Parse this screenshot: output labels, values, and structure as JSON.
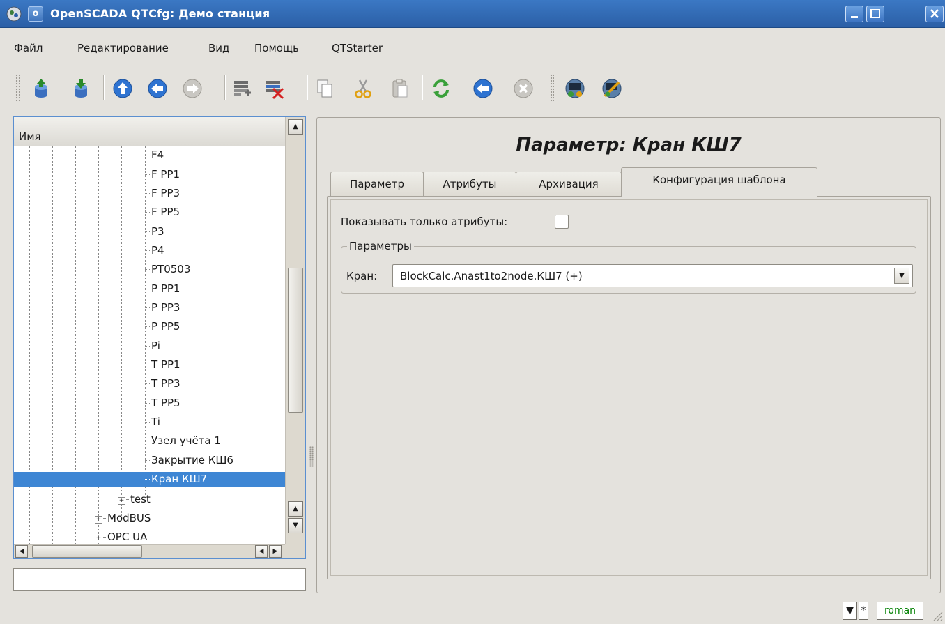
{
  "window": {
    "title": "OpenSCADA QTCfg: Демо станция",
    "menu_button": "o"
  },
  "menubar": {
    "items": [
      "Файл",
      "Редактирование",
      "Вид",
      "Помощь",
      "QTStarter"
    ]
  },
  "toolbar": {
    "icons": [
      "db-load-icon",
      "db-save-icon",
      "up-icon",
      "back-icon",
      "forward-icon",
      "add-item-icon",
      "delete-item-icon",
      "copy-icon",
      "cut-icon",
      "paste-icon",
      "refresh-icon",
      "start-icon",
      "stop-icon",
      "station-icon",
      "station-config-icon"
    ]
  },
  "tree": {
    "header": "Имя",
    "items": [
      "F4",
      "F PP1",
      "F PP3",
      "F PP5",
      "P3",
      "P4",
      "PT0503",
      "P PP1",
      "P PP3",
      "P PP5",
      "Pi",
      "T PP1",
      "T PP3",
      "T PP5",
      "Ti",
      "Узел учёта 1",
      "Закрытие КШ6",
      "Кран КШ7"
    ],
    "selected": "Кран КШ7",
    "collapsed_nodes": [
      "test",
      "ModBUS",
      "OPC UA"
    ]
  },
  "status_input": {
    "value": ""
  },
  "page": {
    "title": "Параметр: Кран КШ7",
    "tabs": [
      "Параметр",
      "Атрибуты",
      "Архивация",
      "Конфигурация шаблона"
    ],
    "active_tab": "Конфигурация шаблона",
    "show_attrs_label": "Показывать только атрибуты:",
    "show_attrs_checked": false,
    "group_title": "Параметры",
    "field_label": "Кран:",
    "field_value": "BlockCalc.Anast1to2node.КШ7 (+)"
  },
  "statusbar": {
    "indicator": "*",
    "user": "roman"
  },
  "colors": {
    "titlebar": "#2b5fa6",
    "selection": "#3e86d4",
    "user_text": "#008000"
  }
}
